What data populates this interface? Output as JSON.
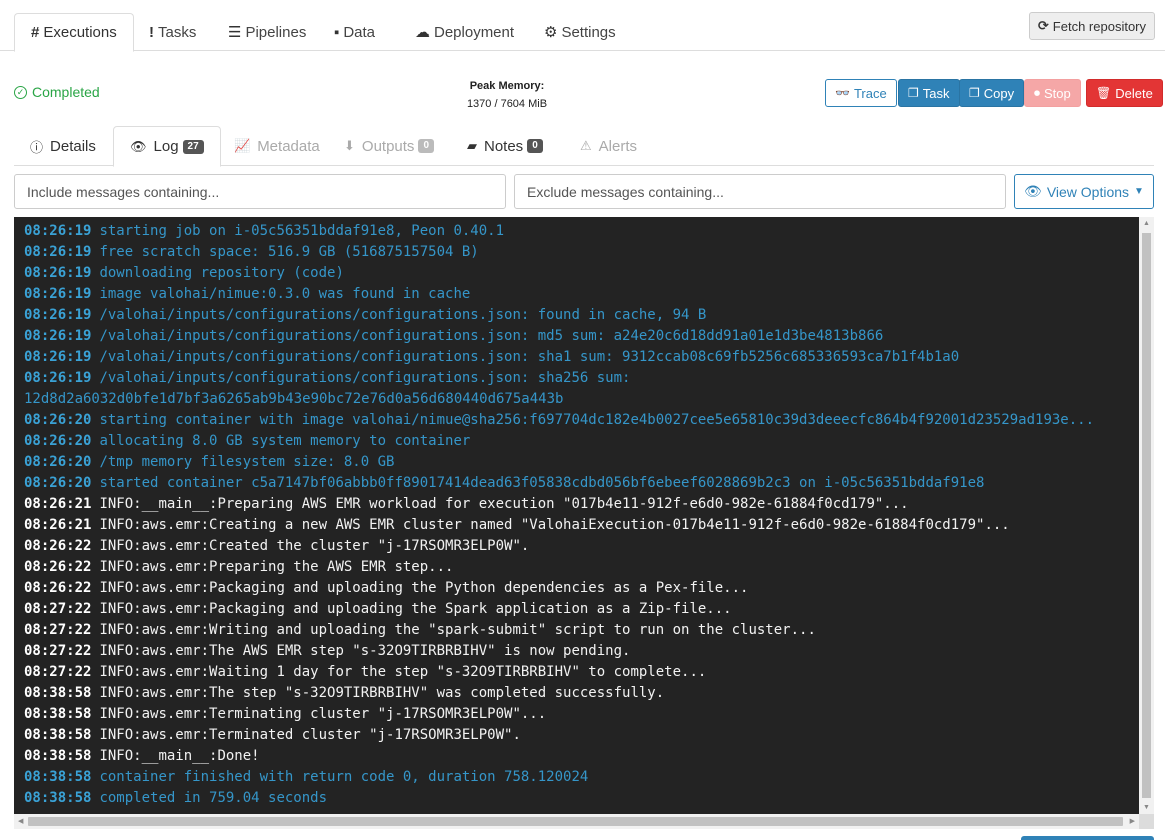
{
  "top_tabs": [
    {
      "icon": "#",
      "label": "Executions"
    },
    {
      "icon": "!",
      "label": "Tasks"
    },
    {
      "icon": "☰",
      "label": "Pipelines"
    },
    {
      "icon": "▪",
      "label": "Data"
    },
    {
      "icon": "☁",
      "label": "Deployment"
    },
    {
      "icon": "⚙",
      "label": "Settings"
    }
  ],
  "fetch_button": "Fetch repository",
  "status": "Completed",
  "peak_memory": {
    "label": "Peak Memory:",
    "value": "1370 / 7604 MiB"
  },
  "actions": {
    "trace": "Trace",
    "task": "Task",
    "copy": "Copy",
    "stop": "Stop",
    "delete": "Delete"
  },
  "sub_tabs": [
    {
      "label": "Details"
    },
    {
      "label": "Log",
      "badge": "27"
    },
    {
      "label": "Metadata"
    },
    {
      "label": "Outputs",
      "badge": "0"
    },
    {
      "label": "Notes",
      "badge": "0"
    },
    {
      "label": "Alerts"
    }
  ],
  "filters": {
    "include_placeholder": "Include messages containing...",
    "exclude_placeholder": "Exclude messages containing..."
  },
  "view_options": "View Options",
  "colors": {
    "system": "#3596c9",
    "user": "#f2f2f2",
    "accent": "#2f82b7",
    "success": "#2aa546",
    "danger": "#e33535"
  },
  "log": [
    {
      "ts": "08:26:19",
      "kind": "sys",
      "msg": "starting job on i-05c56351bddaf91e8, Peon 0.40.1"
    },
    {
      "ts": "08:26:19",
      "kind": "sys",
      "msg": "free scratch space: 516.9 GB (516875157504 B)"
    },
    {
      "ts": "08:26:19",
      "kind": "sys",
      "msg": "downloading repository (code)"
    },
    {
      "ts": "08:26:19",
      "kind": "sys",
      "msg": "image valohai/nimue:0.3.0 was found in cache"
    },
    {
      "ts": "08:26:19",
      "kind": "sys",
      "msg": "/valohai/inputs/configurations/configurations.json: found in cache, 94 B"
    },
    {
      "ts": "08:26:19",
      "kind": "sys",
      "msg": "/valohai/inputs/configurations/configurations.json: md5 sum: a24e20c6d18dd91a01e1d3be4813b866"
    },
    {
      "ts": "08:26:19",
      "kind": "sys",
      "msg": "/valohai/inputs/configurations/configurations.json: sha1 sum: 9312ccab08c69fb5256c685336593ca7b1f4b1a0"
    },
    {
      "ts": "08:26:19",
      "kind": "sys",
      "msg": "/valohai/inputs/configurations/configurations.json: sha256 sum:"
    },
    {
      "ts": "",
      "kind": "sys",
      "msg": "12d8d2a6032d0bfe1d7bf3a6265ab9b43e90bc72e76d0a56d680440d675a443b"
    },
    {
      "ts": "08:26:20",
      "kind": "sys",
      "msg": "starting container with image valohai/nimue@sha256:f697704dc182e4b0027cee5e65810c39d3deeecfc864b4f92001d23529ad193e..."
    },
    {
      "ts": "08:26:20",
      "kind": "sys",
      "msg": "allocating 8.0 GB system memory to container"
    },
    {
      "ts": "08:26:20",
      "kind": "sys",
      "msg": "/tmp memory filesystem size: 8.0 GB"
    },
    {
      "ts": "08:26:20",
      "kind": "sys",
      "msg": "started container c5a7147bf06abbb0ff89017414dead63f05838cdbd056bf6ebeef6028869b2c3 on i-05c56351bddaf91e8"
    },
    {
      "ts": "08:26:21",
      "kind": "usr",
      "msg": "INFO:__main__:Preparing AWS EMR workload for execution \"017b4e11-912f-e6d0-982e-61884f0cd179\"..."
    },
    {
      "ts": "08:26:21",
      "kind": "usr",
      "msg": "INFO:aws.emr:Creating a new AWS EMR cluster named \"ValohaiExecution-017b4e11-912f-e6d0-982e-61884f0cd179\"..."
    },
    {
      "ts": "08:26:22",
      "kind": "usr",
      "msg": "INFO:aws.emr:Created the cluster \"j-17RSOMR3ELP0W\"."
    },
    {
      "ts": "08:26:22",
      "kind": "usr",
      "msg": "INFO:aws.emr:Preparing the AWS EMR step..."
    },
    {
      "ts": "08:26:22",
      "kind": "usr",
      "msg": "INFO:aws.emr:Packaging and uploading the Python dependencies as a Pex-file..."
    },
    {
      "ts": "08:27:22",
      "kind": "usr",
      "msg": "INFO:aws.emr:Packaging and uploading the Spark application as a Zip-file..."
    },
    {
      "ts": "08:27:22",
      "kind": "usr",
      "msg": "INFO:aws.emr:Writing and uploading the \"spark-submit\" script to run on the cluster..."
    },
    {
      "ts": "08:27:22",
      "kind": "usr",
      "msg": "INFO:aws.emr:The AWS EMR step \"s-32O9TIRBRBIHV\" is now pending."
    },
    {
      "ts": "08:27:22",
      "kind": "usr",
      "msg": "INFO:aws.emr:Waiting 1 day for the step \"s-32O9TIRBRBIHV\" to complete..."
    },
    {
      "ts": "08:38:58",
      "kind": "usr",
      "msg": "INFO:aws.emr:The step \"s-32O9TIRBRBIHV\" was completed successfully."
    },
    {
      "ts": "08:38:58",
      "kind": "usr",
      "msg": "INFO:aws.emr:Terminating cluster \"j-17RSOMR3ELP0W\"..."
    },
    {
      "ts": "08:38:58",
      "kind": "usr",
      "msg": "INFO:aws.emr:Terminated cluster \"j-17RSOMR3ELP0W\"."
    },
    {
      "ts": "08:38:58",
      "kind": "usr",
      "msg": "INFO:__main__:Done!"
    },
    {
      "ts": "08:38:58",
      "kind": "sys",
      "msg": "container finished with return code 0, duration 758.120024"
    },
    {
      "ts": "08:38:58",
      "kind": "sys",
      "msg": "completed in 759.04 seconds"
    }
  ]
}
